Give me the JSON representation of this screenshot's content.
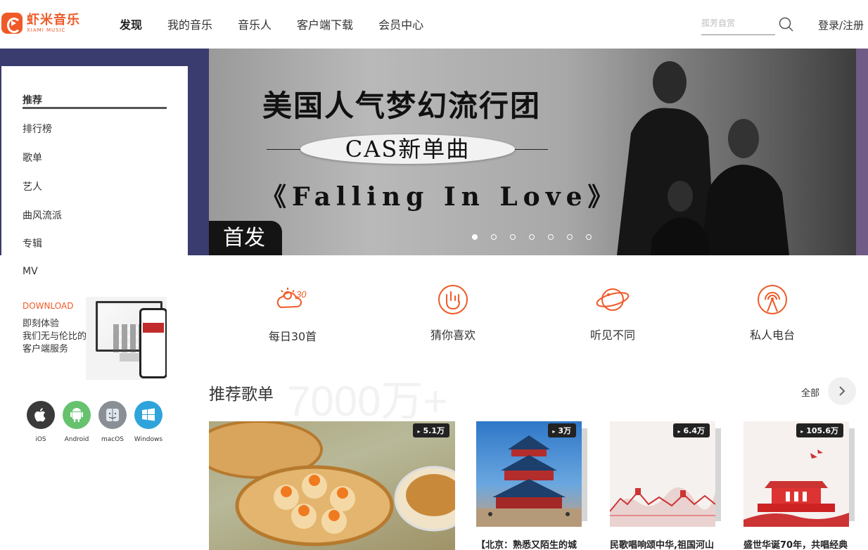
{
  "header": {
    "logo_cn": "虾米音乐",
    "logo_en": "XIAMI MUSIC",
    "nav": [
      "发现",
      "我的音乐",
      "音乐人",
      "客户端下载",
      "会员中心"
    ],
    "search_placeholder": "孤芳自赏",
    "login": "登录/注册"
  },
  "banner": {
    "title": "美国人气梦幻流行团",
    "pill": "CAS新单曲",
    "song": "《Falling In Love》",
    "badge": "首发",
    "dots_total": 7,
    "dots_active": 0
  },
  "sidebar": {
    "items": [
      "推荐",
      "排行榜",
      "歌单",
      "艺人",
      "曲风流派",
      "专辑",
      "MV"
    ],
    "active": 0
  },
  "download": {
    "title": "DOWNLOAD",
    "lines": [
      "即刻体验",
      "我们无与伦比的",
      "客户端服务"
    ],
    "platforms": [
      "iOS",
      "Android",
      "macOS",
      "Windows"
    ]
  },
  "features": [
    "每日30首",
    "猜你喜欢",
    "听见不同",
    "私人电台"
  ],
  "section": {
    "title": "推荐歌单",
    "watermark": "7000万+",
    "all_label": "全部"
  },
  "playlists": [
    {
      "count": "5.1万",
      "title": ""
    },
    {
      "count": "3万",
      "title": "【北京：熟悉又陌生的城"
    },
    {
      "count": "6.4万",
      "title": "民歌唱响颂中华,祖国河山"
    },
    {
      "count": "105.6万",
      "title": "盛世华诞70年，共唱经典"
    }
  ],
  "colors": {
    "accent": "#ef5a28",
    "banner_bg": "#3a3b6e",
    "ios": "#3a3a3a",
    "android": "#66c26e",
    "macos": "#8a8f96",
    "windows": "#2fa4db"
  }
}
